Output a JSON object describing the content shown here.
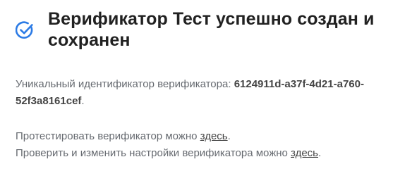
{
  "header": {
    "title": "Верификатор Тест успешно создан и сохранен",
    "icon": "check-circle-icon",
    "accent_color": "#2c7be5"
  },
  "details": {
    "id_label": "Уникальный идентификатор верификатора:",
    "id_value": "6124911d-a37f-4d21-a760-52f3a8161cef",
    "id_suffix": "."
  },
  "actions": {
    "test_text": "Протестировать верификатор можно",
    "test_link": "здесь",
    "edit_text": "Проверить и изменить настройки верификатора можно",
    "edit_link": "здесь",
    "period": "."
  }
}
